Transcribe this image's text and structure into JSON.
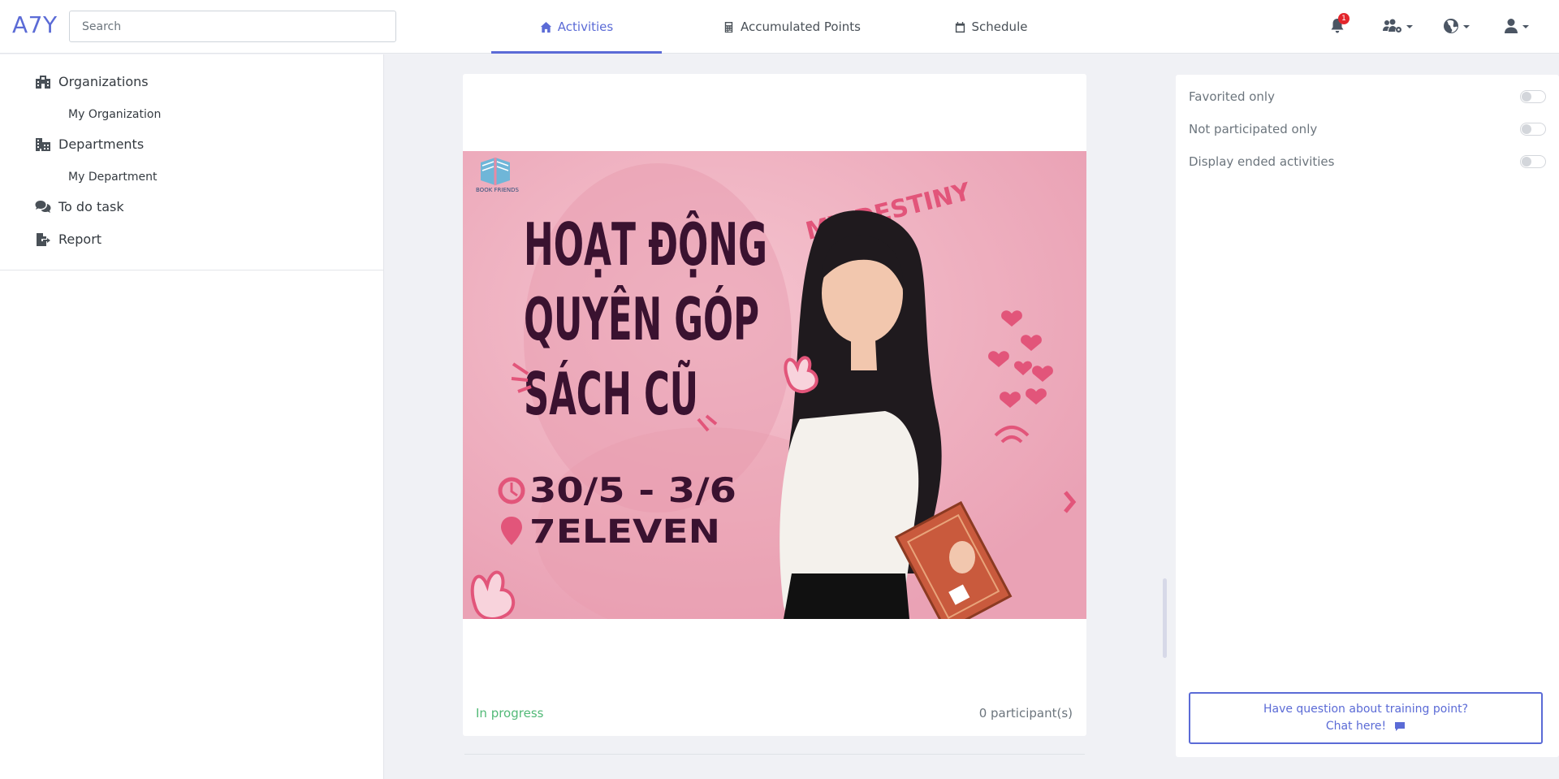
{
  "brand": "A7Y",
  "search": {
    "placeholder": "Search"
  },
  "tabs": [
    {
      "label": "Activities",
      "icon": "home-icon",
      "active": true
    },
    {
      "label": "Accumulated Points",
      "icon": "calculator-icon",
      "active": false
    },
    {
      "label": "Schedule",
      "icon": "calendar-icon",
      "active": false
    }
  ],
  "header_icons": {
    "notifications_count": "1",
    "icons": [
      "bell-icon",
      "users-cog-icon",
      "globe-icon",
      "user-icon"
    ]
  },
  "sidebar": {
    "items": [
      {
        "label": "Organizations",
        "icon": "building-icon"
      },
      {
        "label": "My Organization"
      },
      {
        "label": "Departments",
        "icon": "city-icon"
      },
      {
        "label": "My Department"
      },
      {
        "label": "To do task",
        "icon": "comments-icon"
      },
      {
        "label": "Report",
        "icon": "file-export-icon"
      }
    ]
  },
  "activity_card": {
    "banner": {
      "logo_text": "BOOK FRIENDS",
      "title_lines": [
        "HOẠT ĐỘNG",
        "QUYÊN GÓP",
        "SÁCH CŨ"
      ],
      "slogan": "MY DESTINY",
      "date": "30/5 - 3/6",
      "location": "7ELEVEN"
    },
    "status": "In progress",
    "participants": "0 participant(s)"
  },
  "filters": {
    "options": [
      {
        "label": "Favorited only",
        "on": false
      },
      {
        "label": "Not participated only",
        "on": false
      },
      {
        "label": "Display ended activities",
        "on": false
      }
    ]
  },
  "help": {
    "line1": "Have question about training point?",
    "line2": "Chat here!"
  },
  "colors": {
    "accent": "#5b6bd6",
    "status_green": "#52b977",
    "badge_red": "#e3262c",
    "banner_pink": "#efadbd",
    "banner_text": "#3a1230"
  }
}
